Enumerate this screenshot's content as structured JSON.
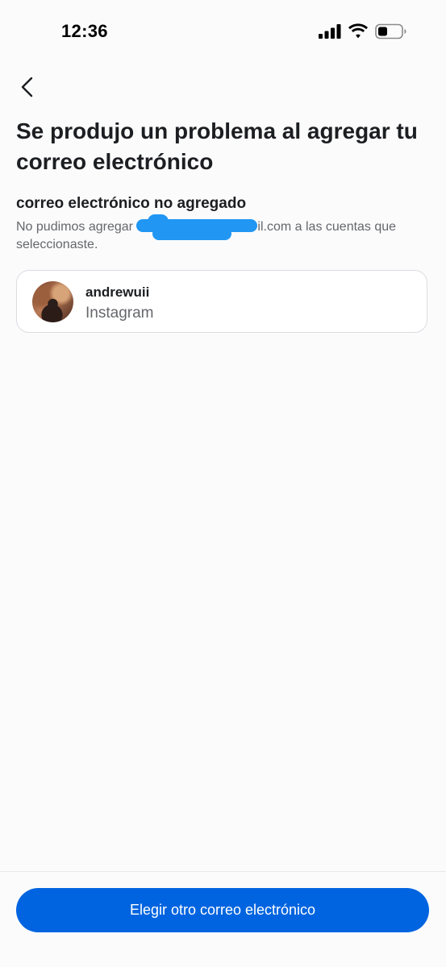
{
  "status_bar": {
    "time": "12:36"
  },
  "icons": {
    "back": "chevron-left-icon",
    "signal": "cellular-signal-icon",
    "wifi": "wifi-icon",
    "battery": "battery-icon"
  },
  "page": {
    "title": "Se produjo un problema al agregar tu correo electrónico",
    "subtitle": "correo electrónico no agregado",
    "description_prefix": "No pudimos agregar ",
    "description_suffix": "il.com a las cuentas que seleccionaste."
  },
  "account": {
    "username": "andrewuii",
    "platform": "Instagram"
  },
  "footer": {
    "button_label": "Elegir otro correo electrónico"
  },
  "colors": {
    "primary": "#0064e0",
    "redaction": "#2196f3",
    "text": "#1c1e21",
    "secondary_text": "#65676b"
  }
}
